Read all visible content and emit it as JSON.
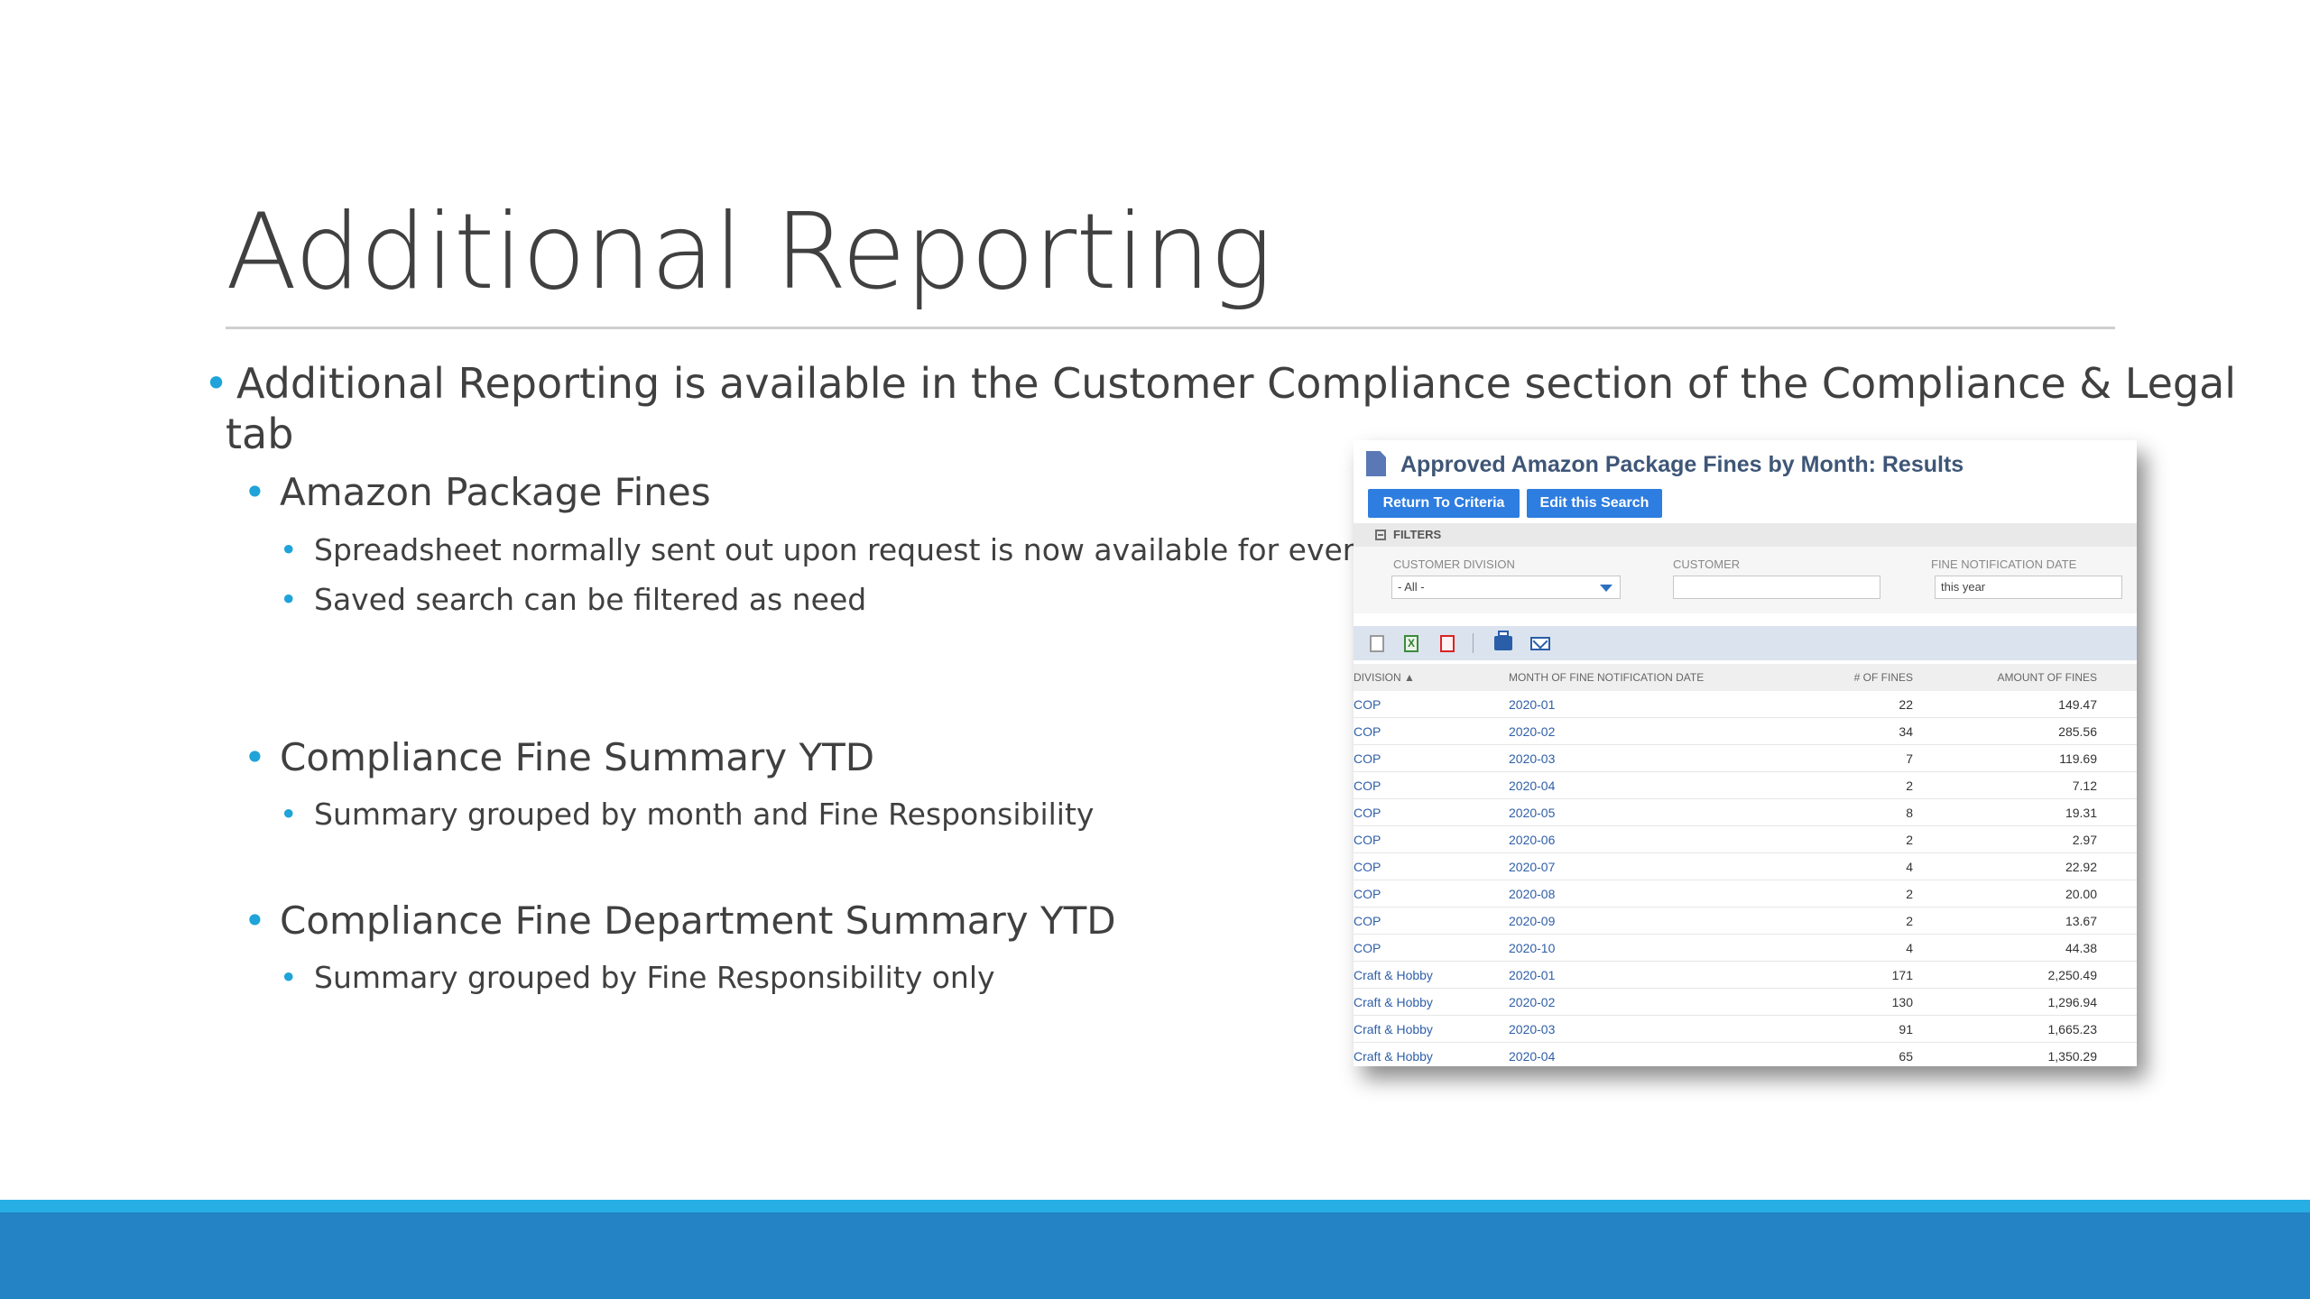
{
  "slide": {
    "title": "Additional Reporting",
    "intro_bullet": "Additional Reporting is available in the Customer Compliance section of the Compliance & Legal",
    "intro_bullet_cont": "tab",
    "sections": [
      {
        "heading": "Amazon Package Fines",
        "items": [
          "Spreadsheet normally sent out upon request is now available for everyone",
          "Saved search can be filtered as need"
        ]
      },
      {
        "heading": "Compliance Fine Summary YTD",
        "items": [
          "Summary grouped by month and Fine Responsibility"
        ]
      },
      {
        "heading": "Compliance Fine Department Summary YTD",
        "items": [
          "Summary grouped by Fine Responsibility only"
        ]
      }
    ],
    "bullet_glyph": "•",
    "accent_color": "#1fa3d9",
    "footer_color": "#2383c4"
  },
  "report": {
    "title": "Approved Amazon Package Fines by Month: Results",
    "buttons": {
      "return": "Return To Criteria",
      "edit": "Edit this Search"
    },
    "filters_label": "FILTERS",
    "filters": {
      "customer_division_label": "CUSTOMER DIVISION",
      "customer_division_value": "- All -",
      "customer_label": "CUSTOMER",
      "customer_value": "",
      "fine_date_label": "FINE NOTIFICATION DATE",
      "fine_date_value": "this year"
    },
    "toolbar_icons": [
      "document-icon",
      "excel-icon",
      "pdf-icon",
      "print-icon",
      "email-icon"
    ],
    "columns": {
      "division": "DIVISION ▲",
      "month": "MONTH OF FINE NOTIFICATION DATE",
      "count": "# OF FINES",
      "amount": "AMOUNT OF FINES"
    },
    "rows": [
      {
        "division": "COP",
        "month": "2020-01",
        "count": "22",
        "amount": "149.47"
      },
      {
        "division": "COP",
        "month": "2020-02",
        "count": "34",
        "amount": "285.56"
      },
      {
        "division": "COP",
        "month": "2020-03",
        "count": "7",
        "amount": "119.69"
      },
      {
        "division": "COP",
        "month": "2020-04",
        "count": "2",
        "amount": "7.12"
      },
      {
        "division": "COP",
        "month": "2020-05",
        "count": "8",
        "amount": "19.31"
      },
      {
        "division": "COP",
        "month": "2020-06",
        "count": "2",
        "amount": "2.97"
      },
      {
        "division": "COP",
        "month": "2020-07",
        "count": "4",
        "amount": "22.92"
      },
      {
        "division": "COP",
        "month": "2020-08",
        "count": "2",
        "amount": "20.00"
      },
      {
        "division": "COP",
        "month": "2020-09",
        "count": "2",
        "amount": "13.67"
      },
      {
        "division": "COP",
        "month": "2020-10",
        "count": "4",
        "amount": "44.38"
      },
      {
        "division": "Craft & Hobby",
        "month": "2020-01",
        "count": "171",
        "amount": "2,250.49"
      },
      {
        "division": "Craft & Hobby",
        "month": "2020-02",
        "count": "130",
        "amount": "1,296.94"
      },
      {
        "division": "Craft & Hobby",
        "month": "2020-03",
        "count": "91",
        "amount": "1,665.23"
      },
      {
        "division": "Craft & Hobby",
        "month": "2020-04",
        "count": "65",
        "amount": "1,350.29"
      }
    ]
  }
}
